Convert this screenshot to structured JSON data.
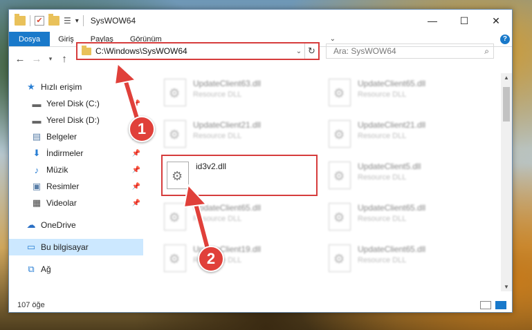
{
  "window": {
    "title": "SysWOW64",
    "controls": {
      "minimize": "—",
      "maximize": "☐",
      "close": "✕"
    }
  },
  "ribbon": {
    "tabs": [
      "Dosya",
      "Giriş",
      "Paylaş",
      "Görünüm"
    ],
    "help": "?"
  },
  "nav": {
    "address": "C:\\Windows\\SysWOW64",
    "search_placeholder": "Ara: SysWOW64"
  },
  "sidebar": {
    "items": [
      {
        "label": "Hızlı erişim",
        "icon": "star-icon"
      },
      {
        "label": "Yerel Disk (C:)",
        "icon": "drive-icon"
      },
      {
        "label": "Yerel Disk (D:)",
        "icon": "drive-icon"
      },
      {
        "label": "Belgeler",
        "icon": "documents-icon"
      },
      {
        "label": "İndirmeler",
        "icon": "download-icon"
      },
      {
        "label": "Müzik",
        "icon": "music-icon"
      },
      {
        "label": "Resimler",
        "icon": "pictures-icon"
      },
      {
        "label": "Videolar",
        "icon": "video-icon"
      },
      {
        "label": "OneDrive",
        "icon": "cloud-icon"
      },
      {
        "label": "Bu bilgisayar",
        "icon": "computer-icon"
      },
      {
        "label": "Ağ",
        "icon": "network-icon"
      }
    ]
  },
  "files": [
    {
      "name": "UpdateClient63.dll",
      "type": "Resource DLL"
    },
    {
      "name": "UpdateClient65.dll",
      "type": "Resource DLL"
    },
    {
      "name": "UpdateClient21.dll",
      "type": "Resource DLL"
    },
    {
      "name": "UpdateClient21.dll",
      "type": "Resource DLL"
    },
    {
      "name": "id3v2.dll",
      "type": ""
    },
    {
      "name": "UpdateClient5.dll",
      "type": "Resource DLL"
    },
    {
      "name": "UpdateClient65.dll",
      "type": "Resource DLL"
    },
    {
      "name": "UpdateClient65.dll",
      "type": "Resource DLL"
    },
    {
      "name": "UpdateClient19.dll",
      "type": "Resource DLL"
    },
    {
      "name": "UpdateClient65.dll",
      "type": "Resource DLL"
    }
  ],
  "status": {
    "count": "107 öğe"
  },
  "annotations": {
    "step1": "1",
    "step2": "2",
    "accent": "#e0403a"
  },
  "colors": {
    "accent": "#1979ca",
    "highlight": "#d63b3b",
    "selection": "#cce8ff"
  }
}
